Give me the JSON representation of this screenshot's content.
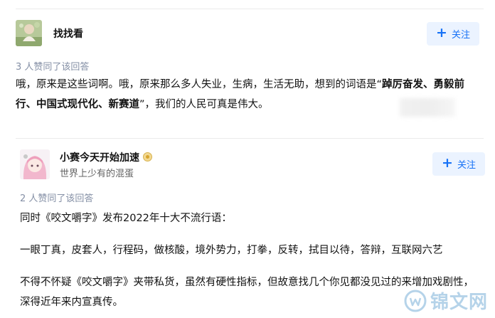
{
  "answers": [
    {
      "author_name": "找找看",
      "author_bio": "",
      "follow_label": "关注",
      "votes_text": "3 人赞同了该回答",
      "content": {
        "p1_text": "哦，原来是这些词啊。哦，原来那么多人失业，生病，生活无助，想到的词语是“",
        "p1_bold": "踔厉奋发、勇毅前行、中国式现代化、新赛道",
        "p1_end": "”，我们的人民可真是伟大。"
      }
    },
    {
      "author_name": "小赛今天开始加速",
      "author_bio": "世界上少有的混蛋",
      "follow_label": "关注",
      "votes_text": "2 人赞同了该回答",
      "content": {
        "p1": "同时《咬文嚼字》发布2022年十大不流行语：",
        "p2": "一眼丁真，皮套人，行程码，做核酸，境外势力，打拳，反转，拭目以待，答辩，互联网六艺",
        "p3": "不得不怀疑《咬文嚼字》夹带私货，虽然有硬性指标，但故意找几个你见都没见过的来增加戏剧性，深得近年来内宣真传。"
      }
    }
  ],
  "watermark": "锦文网",
  "colors": {
    "accent": "#1772f6",
    "follow_bg": "#ebf3ff",
    "muted": "#8590a6"
  }
}
